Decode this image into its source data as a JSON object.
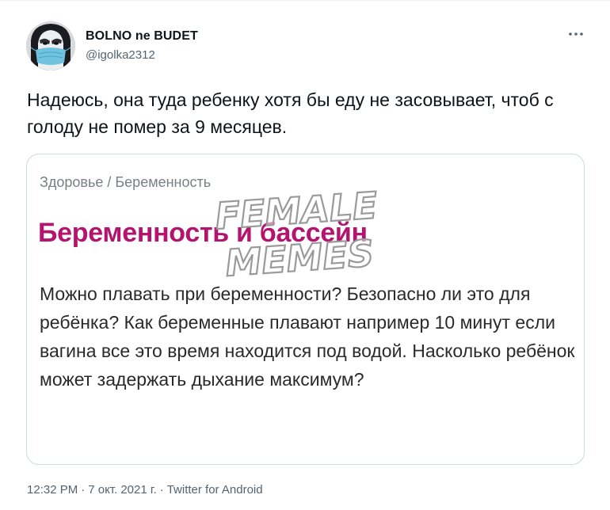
{
  "author": {
    "name": "BOLNO ne BUDET",
    "handle": "@igolka2312"
  },
  "tweet": {
    "text": "Надеюсь, она туда ребенку хотя бы еду не засовывает, чтоб с голоду не помер за 9 месяцев."
  },
  "media": {
    "breadcrumb": "Здоровье / Беременность",
    "title": "Беременность и бассейн",
    "body": "Можно плавать при беременности? Безопасно ли это для ребёнка? Как беременные плавают например 10 минут если вагина все это время находится под водой. Насколько ребёнок может задержать дыхание максимум?",
    "watermark": [
      "FEMALE",
      "MEMES"
    ]
  },
  "meta": {
    "time": "12:32 PM",
    "date": "7 окт. 2021 г.",
    "source": "Twitter for Android",
    "separator": "·"
  },
  "icons": {
    "more": "more-horizontal-icon"
  },
  "colors": {
    "article_title": "#b4146e",
    "secondary_text": "#536471",
    "card_border": "#cfd9de"
  }
}
